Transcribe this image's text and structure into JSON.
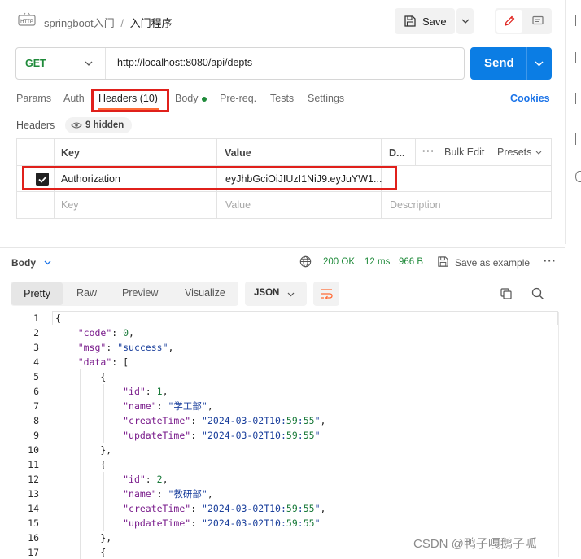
{
  "breadcrumb": {
    "app_badge": "HTTP",
    "collection": "springboot入门",
    "separator": "/",
    "request_name": "入门程序"
  },
  "toolbar": {
    "save_label": "Save"
  },
  "request": {
    "method": "GET",
    "url": "http://localhost:8080/api/depts",
    "send_label": "Send"
  },
  "tabs": [
    {
      "label": "Params"
    },
    {
      "label": "Auth"
    },
    {
      "label": "Headers (10)"
    },
    {
      "label": "Body"
    },
    {
      "label": "Pre-req."
    },
    {
      "label": "Tests"
    },
    {
      "label": "Settings"
    }
  ],
  "cookies_label": "Cookies",
  "headers_section": {
    "title": "Headers",
    "hidden_label": "9 hidden",
    "col_key": "Key",
    "col_value": "Value",
    "col_desc": "D...",
    "bulk_edit": "Bulk Edit",
    "presets": "Presets",
    "row": {
      "key": "Authorization",
      "value": "eyJhbGciOiJIUzI1NiJ9.eyJuYW1..."
    },
    "placeholder_key": "Key",
    "placeholder_value": "Value",
    "placeholder_desc": "Description"
  },
  "response": {
    "body_label": "Body",
    "status": "200 OK",
    "time": "12 ms",
    "size": "966 B",
    "save_example": "Save as example",
    "view_tabs": [
      "Pretty",
      "Raw",
      "Preview",
      "Visualize"
    ],
    "format": "JSON"
  },
  "code_lines": [
    {
      "n": "1",
      "t": "{"
    },
    {
      "n": "2",
      "t": "    \"code\": 0,"
    },
    {
      "n": "3",
      "t": "    \"msg\": \"success\","
    },
    {
      "n": "4",
      "t": "    \"data\": ["
    },
    {
      "n": "5",
      "t": "        {"
    },
    {
      "n": "6",
      "t": "            \"id\": 1,"
    },
    {
      "n": "7",
      "t": "            \"name\": \"学工部\","
    },
    {
      "n": "8",
      "t": "            \"createTime\": \"2024-03-02T10:59:55\","
    },
    {
      "n": "9",
      "t": "            \"updateTime\": \"2024-03-02T10:59:55\""
    },
    {
      "n": "10",
      "t": "        },"
    },
    {
      "n": "11",
      "t": "        {"
    },
    {
      "n": "12",
      "t": "            \"id\": 2,"
    },
    {
      "n": "13",
      "t": "            \"name\": \"教研部\","
    },
    {
      "n": "14",
      "t": "            \"createTime\": \"2024-03-02T10:59:55\","
    },
    {
      "n": "15",
      "t": "            \"updateTime\": \"2024-03-02T10:59:55\""
    },
    {
      "n": "16",
      "t": "        },"
    },
    {
      "n": "17",
      "t": "        {"
    }
  ],
  "watermark": "CSDN @鸭子嘎鹅子呱",
  "colors": {
    "accent_blue": "#1a73e8",
    "send_blue": "#0b7de4",
    "orange": "#ff6c37",
    "status_green": "#1f8a3a",
    "annotation_red": "#e0201b"
  }
}
